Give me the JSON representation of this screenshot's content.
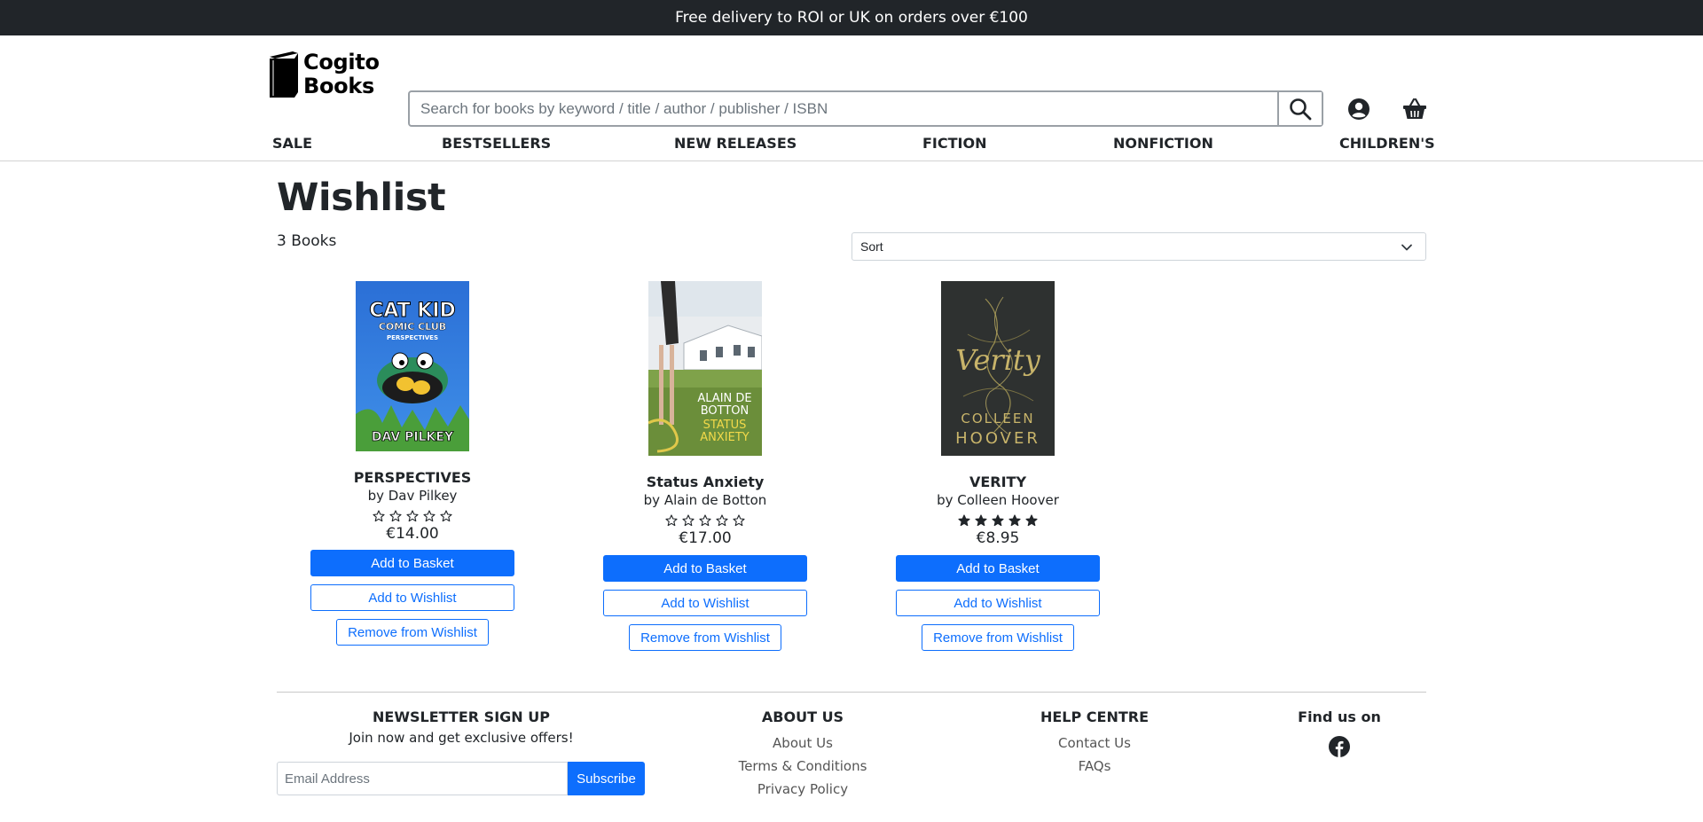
{
  "promo": {
    "text": "Free delivery to ROI or UK on orders over €100"
  },
  "logo": {
    "line1": "Cogito",
    "line2": "Books"
  },
  "search": {
    "placeholder": "Search for books by keyword / title / author / publisher / ISBN"
  },
  "nav": [
    "SALE",
    "BESTSELLERS",
    "NEW RELEASES",
    "FICTION",
    "NONFICTION",
    "CHILDREN'S"
  ],
  "page": {
    "title": "Wishlist",
    "count": "3 Books",
    "sort_label": "Sort"
  },
  "books": [
    {
      "title": "PERSPECTIVES",
      "author": "by Dav Pilkey",
      "price": "€14.00",
      "rating": 0,
      "cover_text": [
        "CAT KID",
        "COMIC CLUB",
        "PERSPECTIVES",
        "DAV PILKEY"
      ],
      "add_basket": "Add to Basket",
      "add_wishlist": "Add to Wishlist",
      "remove_wishlist": "Remove from Wishlist"
    },
    {
      "title": "Status Anxiety",
      "author": "by Alain de Botton",
      "price": "€17.00",
      "rating": 0,
      "cover_text": [
        "ALAIN DE",
        "BOTTON",
        "STATUS",
        "ANXIETY"
      ],
      "add_basket": "Add to Basket",
      "add_wishlist": "Add to Wishlist",
      "remove_wishlist": "Remove from Wishlist"
    },
    {
      "title": "VERITY",
      "author": "by Colleen Hoover",
      "price": "€8.95",
      "rating": 5,
      "cover_text": [
        "Verity",
        "COLLEEN",
        "HOOVER"
      ],
      "add_basket": "Add to Basket",
      "add_wishlist": "Add to Wishlist",
      "remove_wishlist": "Remove from Wishlist"
    }
  ],
  "footer": {
    "newsletter": {
      "heading": "NEWSLETTER SIGN UP",
      "sub": "Join now and get exclusive offers!",
      "email_placeholder": "Email Address",
      "button": "Subscribe"
    },
    "about": {
      "heading": "ABOUT US",
      "links": [
        "About Us",
        "Terms & Conditions",
        "Privacy Policy"
      ]
    },
    "help": {
      "heading": "HELP CENTRE",
      "links": [
        "Contact Us",
        "FAQs"
      ]
    },
    "social": {
      "heading": "Find us on",
      "icon": "facebook-icon"
    }
  },
  "colors": {
    "accent": "#0d6efd",
    "dark_bar": "#212529"
  }
}
